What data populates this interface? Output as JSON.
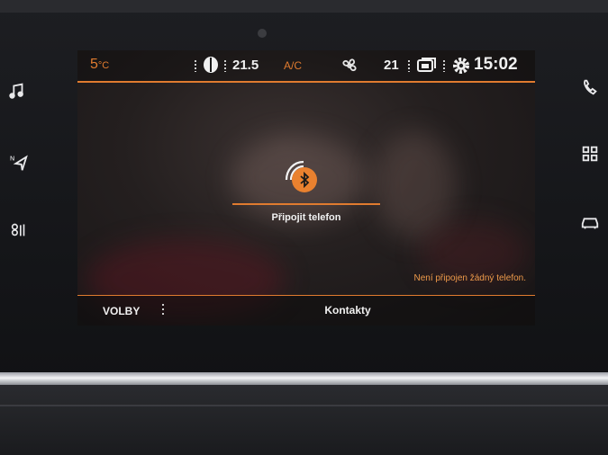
{
  "status_bar": {
    "outside_temp": "5",
    "outside_temp_unit": "°C",
    "fan_icon": "steering-heat-icon",
    "cabin_temp_left": "21.5",
    "ac_label": "A/C",
    "fan_speed_icon": "fan-icon",
    "cabin_temp_right": "21",
    "recirc_icon": "recirculation-icon",
    "settings_icon": "gear-icon",
    "clock": "15:02",
    "accent_color": "#e07b2f"
  },
  "left_controls": [
    {
      "name": "music-icon"
    },
    {
      "name": "navigation-icon"
    },
    {
      "name": "climate-icon"
    }
  ],
  "right_controls": [
    {
      "name": "phone-icon"
    },
    {
      "name": "apps-icon"
    },
    {
      "name": "car-icon"
    }
  ],
  "main": {
    "bluetooth_icon": "bluetooth-icon",
    "connect_label": "Připojit telefon",
    "no_phone_message": "Není připojen žádný telefon."
  },
  "bottom_bar": {
    "options_label": "VOLBY",
    "contacts_label": "Kontakty"
  }
}
